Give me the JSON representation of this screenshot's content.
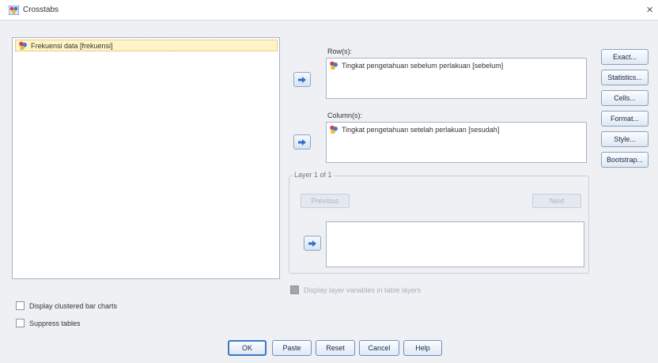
{
  "window": {
    "title": "Crosstabs",
    "close_glyph": "×",
    "icon": "crosstabs-icon"
  },
  "source_list": {
    "items": [
      {
        "label": "Frekuensi data [frekuensi]",
        "icon": "nominal-variable-icon"
      }
    ]
  },
  "rows": {
    "label": "Row(s):",
    "items": [
      {
        "label": "Tingkat pengetahuan sebelum perlakuan [sebelum]",
        "icon": "nominal-variable-icon"
      }
    ]
  },
  "columns": {
    "label": "Column(s):",
    "items": [
      {
        "label": "Tingkat pengetahuan setelah perlakuan [sesudah]",
        "icon": "nominal-variable-icon"
      }
    ]
  },
  "layer": {
    "title": "Layer 1 of 1",
    "previous_label": "Previous",
    "next_label": "Next"
  },
  "side_buttons": {
    "exact": "Exact...",
    "statistics": "Statistics...",
    "cells": "Cells...",
    "format": "Format...",
    "style": "Style...",
    "bootstrap": "Bootstrap..."
  },
  "options": {
    "display_layer": "Display layer variables in table layers",
    "display_clustered": "Display clustered bar charts",
    "suppress_tables": "Suppress tables"
  },
  "footer": {
    "ok": "OK",
    "paste": "Paste",
    "reset": "Reset",
    "cancel": "Cancel",
    "help": "Help"
  },
  "colors": {
    "selected_item_bg": "#fff3c7",
    "default_button_border": "#3b78c9",
    "arrow_icon": "#2f6fd0"
  }
}
